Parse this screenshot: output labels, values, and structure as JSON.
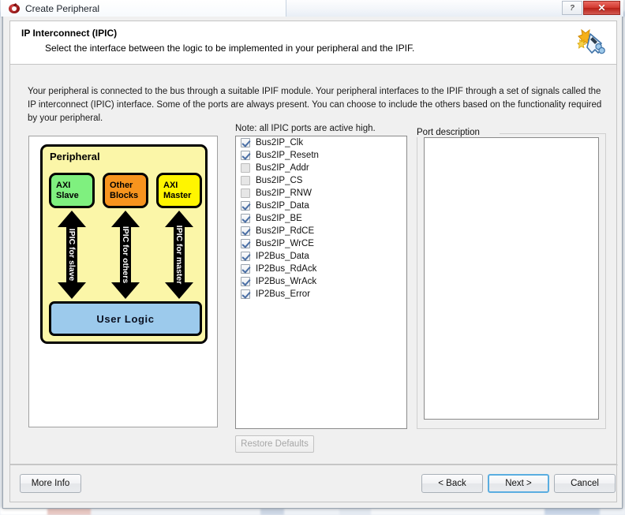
{
  "window": {
    "title": "Create Peripheral",
    "app_icon": "xilinx-logo-icon",
    "help_button": "?",
    "close_button": "✕"
  },
  "header": {
    "title": "IP Interconnect (IPIC)",
    "subtitle": "Select the interface between the logic to be implemented in your peripheral and the IPIF.",
    "icon": "create-peripheral-wizard-icon"
  },
  "intro": {
    "text": "Your peripheral is connected to the bus through a suitable IPIF module. Your peripheral interfaces to the IPIF through a set of signals called the IP interconnect (IPIC) interface. Some of the ports are always present. You can choose to include the others based on the functionality required by your peripheral."
  },
  "diagram": {
    "container_label": "Peripheral",
    "blocks": [
      {
        "label_line1": "AXI",
        "label_line2": "Slave",
        "color": "#7ff07f"
      },
      {
        "label_line1": "Other",
        "label_line2": "Blocks",
        "color": "#f7941e"
      },
      {
        "label_line1": "AXI",
        "label_line2": "Master",
        "color": "#fff500"
      }
    ],
    "arrows": [
      {
        "label": "IPIC for slave"
      },
      {
        "label": "IPIC for others"
      },
      {
        "label": "IPIC for master"
      }
    ],
    "user_logic_label": "User Logic",
    "user_logic_color": "#9ccaec",
    "peripheral_color": "#fbf6a8"
  },
  "ports": {
    "note": "Note: all IPIC ports are active high.",
    "items": [
      {
        "label": "Bus2IP_Clk",
        "checked": true,
        "enabled": true
      },
      {
        "label": "Bus2IP_Resetn",
        "checked": true,
        "enabled": true
      },
      {
        "label": "Bus2IP_Addr",
        "checked": false,
        "enabled": false
      },
      {
        "label": "Bus2IP_CS",
        "checked": false,
        "enabled": false
      },
      {
        "label": "Bus2IP_RNW",
        "checked": false,
        "enabled": false
      },
      {
        "label": "Bus2IP_Data",
        "checked": true,
        "enabled": true
      },
      {
        "label": "Bus2IP_BE",
        "checked": true,
        "enabled": true
      },
      {
        "label": "Bus2IP_RdCE",
        "checked": true,
        "enabled": true
      },
      {
        "label": "Bus2IP_WrCE",
        "checked": true,
        "enabled": true
      },
      {
        "label": "IP2Bus_Data",
        "checked": true,
        "enabled": true
      },
      {
        "label": "IP2Bus_RdAck",
        "checked": true,
        "enabled": true
      },
      {
        "label": "IP2Bus_WrAck",
        "checked": true,
        "enabled": true
      },
      {
        "label": "IP2Bus_Error",
        "checked": true,
        "enabled": true
      }
    ],
    "restore_defaults_label": "Restore Defaults",
    "restore_defaults_enabled": false
  },
  "port_description": {
    "legend": "Port description",
    "content": ""
  },
  "footer": {
    "more_info_label": "More Info",
    "back_label": "< Back",
    "next_label": "Next >",
    "cancel_label": "Cancel"
  },
  "colors": {
    "accent_focus": "#5aade0",
    "close_red": "#c0392b",
    "panel_bg": "#f0f0f0"
  }
}
